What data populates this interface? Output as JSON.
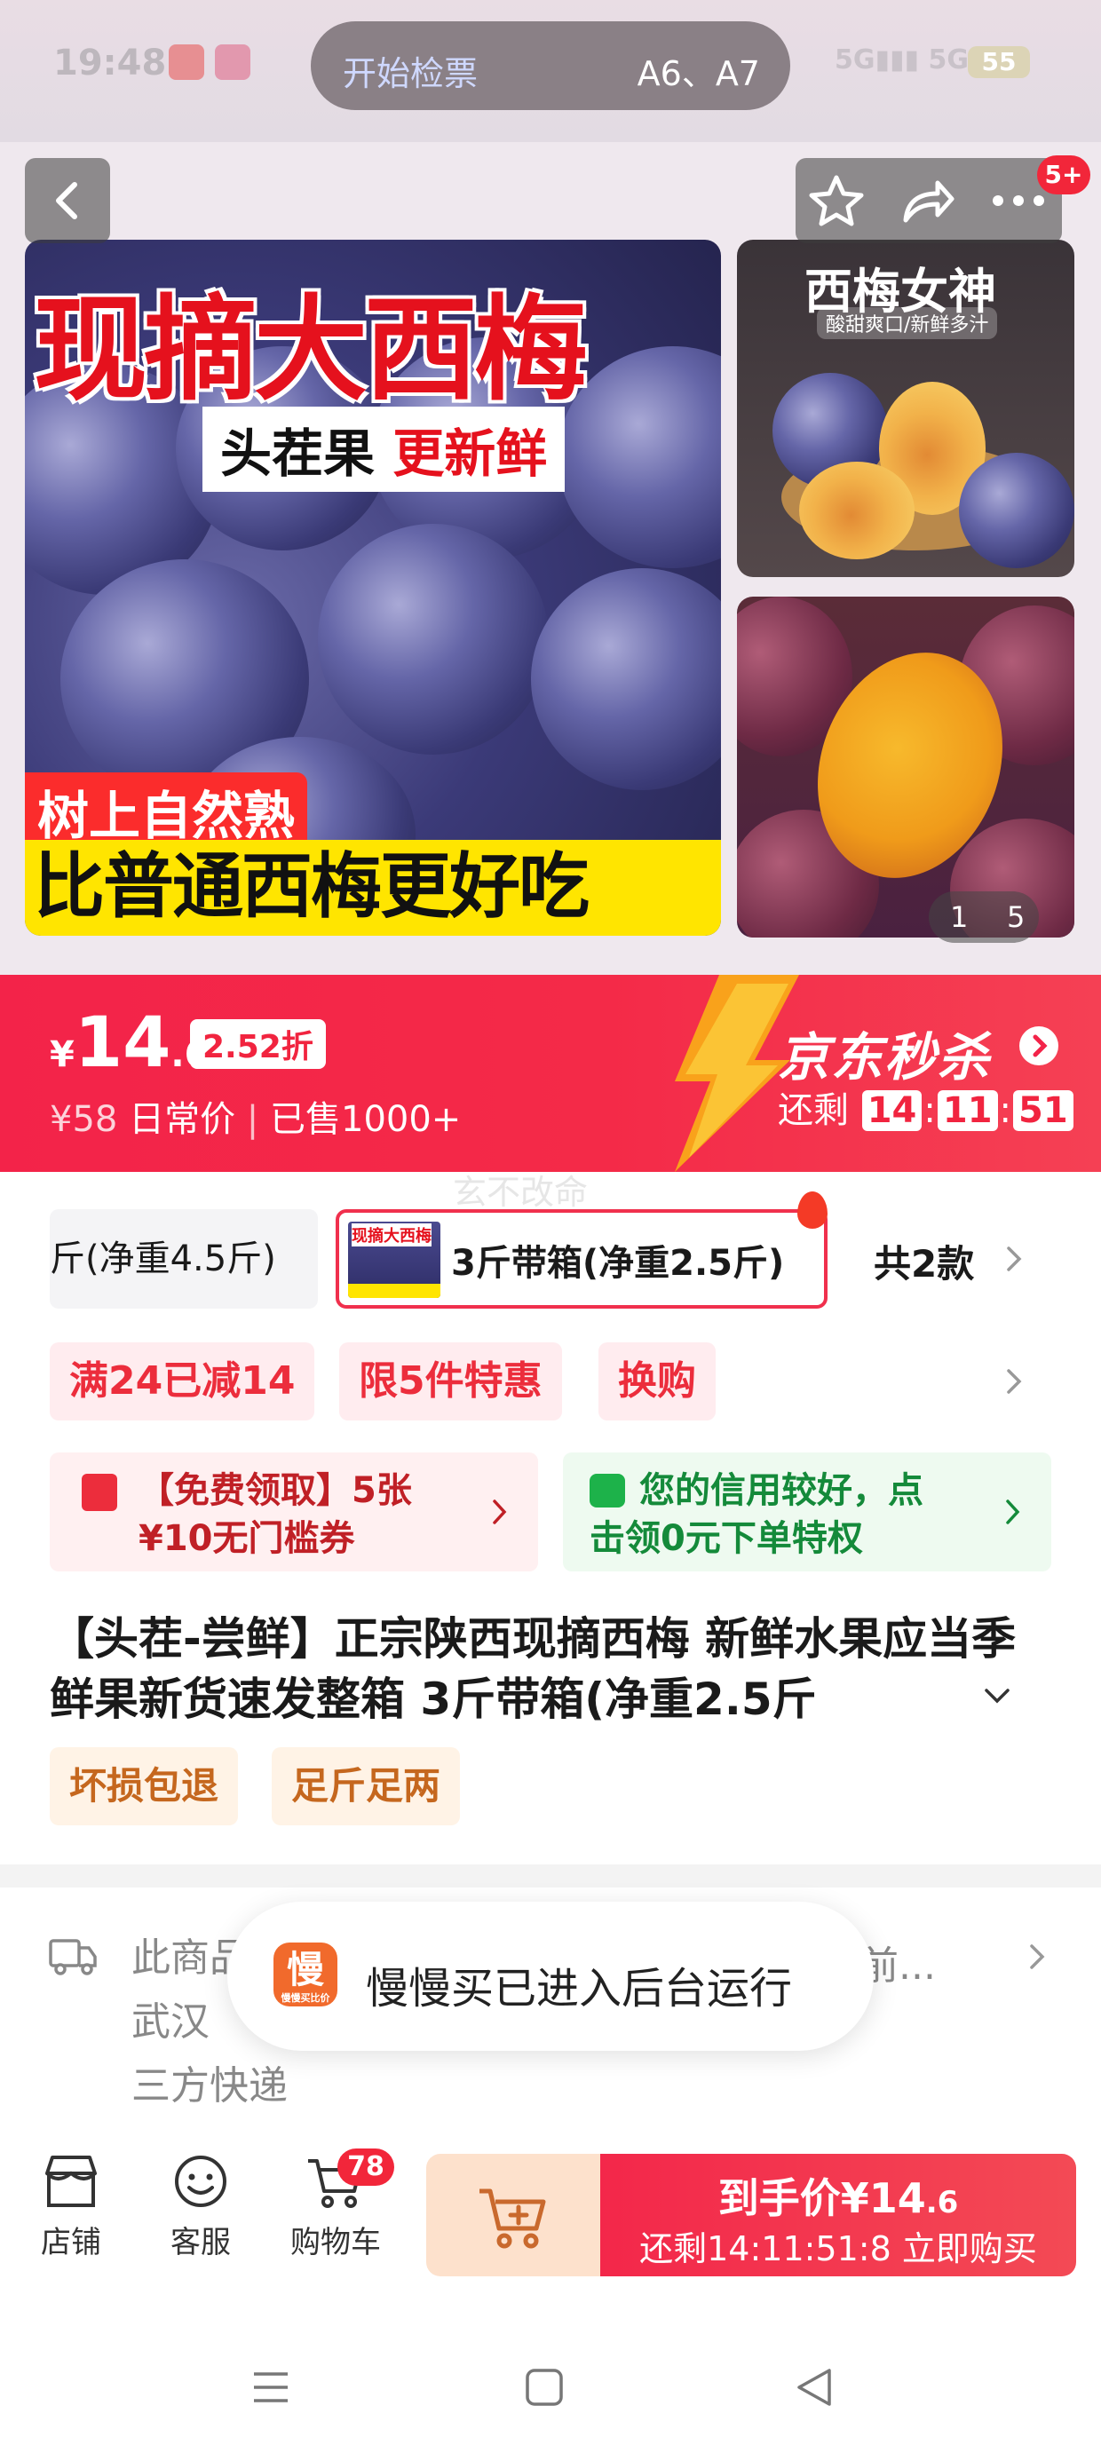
{
  "status_bar": {
    "time": "19:48",
    "ticket_left": "开始检票",
    "ticket_right": "A6、A7",
    "signal": "5G",
    "battery": "55"
  },
  "gallery": {
    "cart_badge": "5+",
    "main_title": "现摘大西梅",
    "tag_left": "头茬果",
    "tag_right": "更新鲜",
    "tag_ripe": "树上自然熟",
    "tag_tasty": "比普通西梅更好吃",
    "side_title": "西梅女神",
    "side_sub": "酸甜爽口/新鲜多汁",
    "counter_left": "1",
    "counter_right": "5"
  },
  "price": {
    "currency": "¥",
    "integer": "14",
    "decimal": ".6",
    "discount": "2.52折",
    "orig": "¥58",
    "orig_label": "日常价",
    "sold": "已售1000+",
    "seckill": "京东秒杀",
    "remain_label": "还剩",
    "h": "14",
    "m": "11",
    "s": "51"
  },
  "watermark": "玄不改命",
  "variants": {
    "v1": "斤(净重4.5斤)",
    "v2_thumb": "现摘大西梅",
    "v2": "3斤带箱(净重2.5斤)",
    "total": "共2款"
  },
  "promos": [
    "满24已减14",
    "限5件特惠",
    "换购"
  ],
  "coupon1": {
    "line1": "【免费领取】5张",
    "line2": "¥10无门槛券"
  },
  "coupon2": {
    "line1": "您的信用较好，点",
    "line2": "击领0元下单特权"
  },
  "product_title": "【头茬-尝鲜】正宗陕西现摘西梅 新鲜水果应当季鲜果新货速发整箱 3斤带箱(净重2.5斤",
  "chips": [
    "坏损包退",
    "足斤足两"
  ],
  "shipping": {
    "line1": "此商品",
    "line2": "武汉",
    "line3": "三方快递",
    "tail": "前..."
  },
  "toast": {
    "icon": "慢",
    "icon_small": "慢慢买比价",
    "text": "慢慢买已进入后台运行"
  },
  "bottom": {
    "shop": "店铺",
    "service": "客服",
    "cart": "购物车",
    "cart_count": "78",
    "buy_label": "到手价",
    "buy_cur": "¥",
    "buy_int": "14",
    "buy_dec": ".6",
    "buy_remain": "还剩14:11:51:8",
    "buy_now": "立即购买"
  },
  "colors": {
    "accent": "#f32349",
    "promo": "#ec2d3c",
    "green": "#148a3a",
    "chip": "#c5671e"
  }
}
